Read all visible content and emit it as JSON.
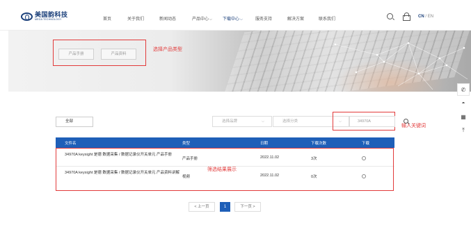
{
  "brand": {
    "name_cn": "美国韵科技",
    "name_en": "MEGA TECHNOLOGY",
    "color": "#1a3f7a"
  },
  "nav": {
    "items": [
      {
        "label": "首页",
        "active": false
      },
      {
        "label": "关于我们",
        "active": false
      },
      {
        "label": "新闻动态",
        "active": false
      },
      {
        "label": "产品中心",
        "active": false,
        "dropdown": true
      },
      {
        "label": "下载中心",
        "active": true,
        "dropdown": true
      },
      {
        "label": "服务支持",
        "active": false
      },
      {
        "label": "解决方案",
        "active": false
      },
      {
        "label": "联系我们",
        "active": false
      }
    ],
    "search_icon": "search-icon",
    "user_icon": "user-icon",
    "lang_cn": "CN",
    "lang_sep": "/",
    "lang_en": "EN"
  },
  "banner": {
    "type_buttons": [
      "产品手册",
      "产品资料"
    ],
    "annotation": "选择产品类型"
  },
  "side_tools": [
    "phone-icon",
    "headset-icon",
    "qr-code-icon",
    "back-to-top-icon"
  ],
  "filters": {
    "all_label": "全部",
    "brand_placeholder": "选择品牌",
    "category_placeholder": "选择分类",
    "keyword_value": "34970A",
    "keyword_annotation": "输入关键词"
  },
  "table": {
    "headers": [
      "文件名",
      "类型",
      "日期",
      "下载次数",
      "下载"
    ],
    "annotation": "筛选结果展示",
    "rows": [
      {
        "name": "34970A keysight 是德 数据采集 / 数据记录仪开关单元 产品手册",
        "type": "产品手册",
        "date": "2022.11.02",
        "count": "3次"
      },
      {
        "name": "34970A keysight 是德 数据采集 / 数据记录仪开关单元 产品资料讲解",
        "type": "视频",
        "date": "2022.11.02",
        "count": "0次"
      }
    ]
  },
  "pagination": {
    "prev": "< 上一页",
    "current": "1",
    "next": "下一页 >"
  },
  "colors": {
    "accent": "#1e5fb8",
    "annotation": "#e23a3a"
  }
}
